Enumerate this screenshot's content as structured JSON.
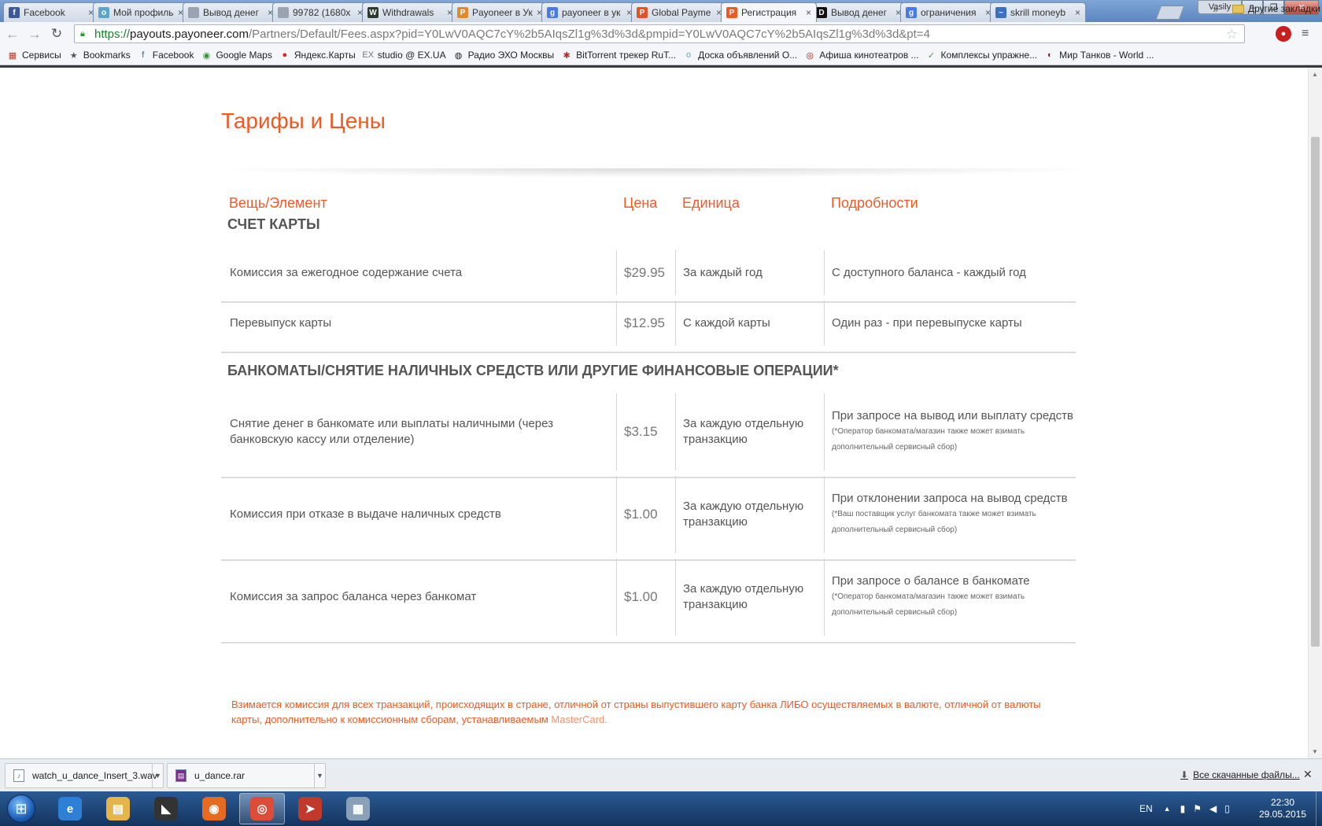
{
  "browser": {
    "tabs": [
      {
        "label": "Facebook",
        "icon": "facebook-icon",
        "color": "#3b5998",
        "glyph": "f"
      },
      {
        "label": "Мой профиль",
        "icon": "olx-icon",
        "color": "#5ba5c9",
        "glyph": "o"
      },
      {
        "label": "Вывод денег",
        "icon": "page-icon",
        "color": "#9aa4b1",
        "glyph": ""
      },
      {
        "label": "99782 (1680x",
        "icon": "page-icon",
        "color": "#9aa4b1",
        "glyph": ""
      },
      {
        "label": "Withdrawals",
        "icon": "withdrawals-icon",
        "color": "#2d3b2d",
        "glyph": "W"
      },
      {
        "label": "Payoneer в Ук",
        "icon": "payoneer-icon",
        "color": "#e08a2c",
        "glyph": "P"
      },
      {
        "label": "payoneer в ук",
        "icon": "google-icon",
        "color": "#4a7be0",
        "glyph": "g"
      },
      {
        "label": "Global Payme",
        "icon": "payoneer-icon",
        "color": "#e2532a",
        "glyph": "P"
      },
      {
        "label": "Регистрация",
        "icon": "payoneer-icon",
        "color": "#f25922",
        "glyph": "P",
        "active": true
      },
      {
        "label": "Вывод денег",
        "icon": "dou-icon",
        "color": "#111111",
        "glyph": "D"
      },
      {
        "label": "ограничения",
        "icon": "google-icon",
        "color": "#4a7be0",
        "glyph": "g"
      },
      {
        "label": "skrill moneyb",
        "icon": "chart-icon",
        "color": "#3b6fc1",
        "glyph": "~"
      }
    ],
    "user": "Vasily",
    "window_buttons": {
      "minimize": "–",
      "maximize": "❐",
      "close": "✕"
    },
    "address": {
      "scheme": "https://",
      "host": "payouts.",
      "domain": "payoneer.com",
      "path": "/Partners/Default/Fees.aspx?pid=Y0LwV0AQC7cY%2b5AIqsZl1g%3d%3d&pmpid=Y0LwV0AQC7cY%2b5AIqsZl1g%3d%3d&pt=4"
    },
    "bookmarks": [
      {
        "label": "Сервисы",
        "icon": "apps-icon",
        "glyph": "▦",
        "color": "#c0392b"
      },
      {
        "label": "Bookmarks",
        "icon": "star-icon",
        "glyph": "★",
        "color": "#555555"
      },
      {
        "label": "Facebook",
        "icon": "facebook-icon",
        "glyph": "f",
        "color": "#3b5998"
      },
      {
        "label": "Google Maps",
        "icon": "maps-icon",
        "glyph": "◉",
        "color": "#3a8f3a"
      },
      {
        "label": "Яндекс.Карты",
        "icon": "pin-icon",
        "glyph": "●",
        "color": "#e02020"
      },
      {
        "label": "studio @ EX.UA",
        "icon": "ex-icon",
        "glyph": "EX",
        "color": "#777777"
      },
      {
        "label": "Радио ЭХО Москвы",
        "icon": "echo-icon",
        "glyph": "◍",
        "color": "#222222"
      },
      {
        "label": "BitTorrent трекер RuT...",
        "icon": "torrent-icon",
        "glyph": "✱",
        "color": "#b03030"
      },
      {
        "label": "Доска объявлений О...",
        "icon": "olx-icon",
        "glyph": "o",
        "color": "#5ba5c9"
      },
      {
        "label": "Афиша кинотеатров ...",
        "icon": "afisha-icon",
        "glyph": "◎",
        "color": "#a02020"
      },
      {
        "label": "Комплексы упражне...",
        "icon": "leaf-icon",
        "glyph": "✓",
        "color": "#4a9e3a"
      },
      {
        "label": "Мир Танков - World ...",
        "icon": "tanks-icon",
        "glyph": "◐",
        "color": "#8a1f1f"
      }
    ],
    "bookmarks_more": "»",
    "other_bookmarks": "Другие закладки"
  },
  "page": {
    "title": "Тарифы и Цены",
    "columns": {
      "item": "Вещь/Элемент",
      "price": "Цена",
      "unit": "Единица",
      "details": "Подробности"
    },
    "sections": [
      {
        "title": "СЧЕТ КАРТЫ",
        "rows": [
          {
            "item": "Комиссия за ежегодное содержание счета",
            "price": "$29.95",
            "unit": "За каждый год",
            "details": "С доступного баланса - каждый год",
            "note": ""
          },
          {
            "item": "Перевыпуск карты",
            "price": "$12.95",
            "unit": "С каждой карты",
            "details": "Один раз - при перевыпуске карты",
            "note": ""
          }
        ]
      },
      {
        "title": "БАНКОМАТЫ/СНЯТИЕ НАЛИЧНЫХ СРЕДСТВ ИЛИ ДРУГИЕ ФИНАНСОВЫЕ ОПЕРАЦИИ*",
        "rows": [
          {
            "item": "Снятие денег в банкомате или выплаты наличными (через банковскую кассу или отделение)",
            "price": "$3.15",
            "unit": "За каждую отдельную транзакцию",
            "details": "При запросе на вывод или выплату средств",
            "note": "(*Оператор банкомата/магазин также может взимать дополнительный сервисный сбор)"
          },
          {
            "item": "Комиссия при отказе в выдаче наличных средств",
            "price": "$1.00",
            "unit": "За каждую отдельную транзакцию",
            "details": "При отклонении запроса на вывод средств",
            "note": "(*Ваш поставщик услуг банкомата также может взимать дополнительный сервисный сбор)"
          },
          {
            "item": "Комиссия за запрос баланса через банкомат",
            "price": "$1.00",
            "unit": "За каждую отдельную транзакцию",
            "details": "При запросе о балансе в банкомате",
            "note": "(*Оператор банкомата/магазин также может взимать дополнительный сервисный сбор)"
          }
        ]
      }
    ],
    "footnote": {
      "text": "Взимается комиссия для всех транзакций, происходящих в стране, отличной от страны выпустившего карту банка ЛИБО осуществляемых в валюте, отличной от валюты карты, дополнительно к комиссионным сборам, устанавливаемым ",
      "link": "MasterCard."
    }
  },
  "downloads": {
    "items": [
      {
        "name": "watch_u_dance_Insert_3.wav",
        "icon": "audio-file-icon"
      },
      {
        "name": "u_dance.rar",
        "icon": "rar-file-icon"
      }
    ],
    "show_all": "Все скачанные файлы...",
    "close": "✕"
  },
  "taskbar": {
    "apps": [
      {
        "name": "internet-explorer",
        "glyph": "e",
        "color": "#2e7fd6"
      },
      {
        "name": "file-explorer",
        "glyph": "▤",
        "color": "#e5b44a"
      },
      {
        "name": "foobar",
        "glyph": "◣",
        "color": "#333333"
      },
      {
        "name": "firefox",
        "glyph": "◉",
        "color": "#e66a1f"
      },
      {
        "name": "chrome",
        "glyph": "◎",
        "color": "#dd4b39",
        "active": true
      },
      {
        "name": "filezilla",
        "glyph": "➤",
        "color": "#c0392b"
      },
      {
        "name": "calculator",
        "glyph": "▦",
        "color": "#8aa0b8"
      }
    ],
    "language": "EN",
    "time": "22:30",
    "date": "29.05.2015"
  },
  "colors": {
    "accent": "#f25922",
    "text": "#555555"
  }
}
